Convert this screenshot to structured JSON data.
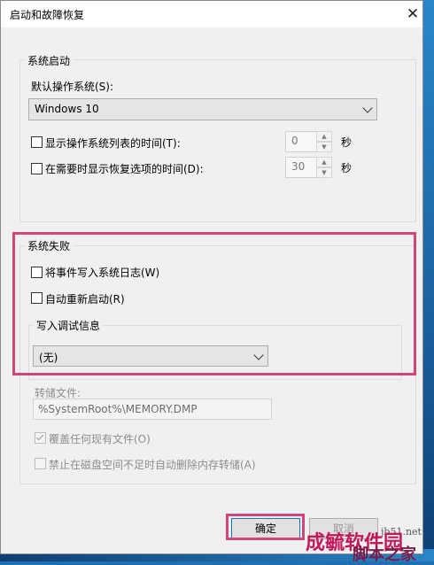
{
  "window": {
    "title": "启动和故障恢复",
    "close_glyph": "✕"
  },
  "system_startup": {
    "legend": "系统启动",
    "default_os_label": "默认操作系统(S):",
    "default_os_value": "Windows 10",
    "show_list_label": "显示操作系统列表的时间(T):",
    "show_list_value": "0",
    "show_recovery_label": "在需要时显示恢复选项的时间(D):",
    "show_recovery_value": "30",
    "seconds_unit": "秒"
  },
  "system_failure": {
    "legend": "系统失败",
    "write_event_label": "将事件写入系统日志(W)",
    "auto_restart_label": "自动重新启动(R)",
    "debug_info_legend": "写入调试信息",
    "debug_info_value": "(无)",
    "dump_file_label": "转储文件:",
    "dump_file_value": "%SystemRoot%\\MEMORY.DMP",
    "overwrite_label": "覆盖任何现有文件(O)",
    "disable_auto_delete_label": "禁止在磁盘空间不足时自动删除内存转储(A)"
  },
  "buttons": {
    "ok_label": "确定",
    "cancel_label": "取消"
  },
  "watermark": {
    "line1": "成毓软件园",
    "line2": "脚本之家",
    "corner_text": "jb51.net"
  },
  "colors": {
    "highlight": "#d0457a",
    "watermark": "#c2185b"
  }
}
